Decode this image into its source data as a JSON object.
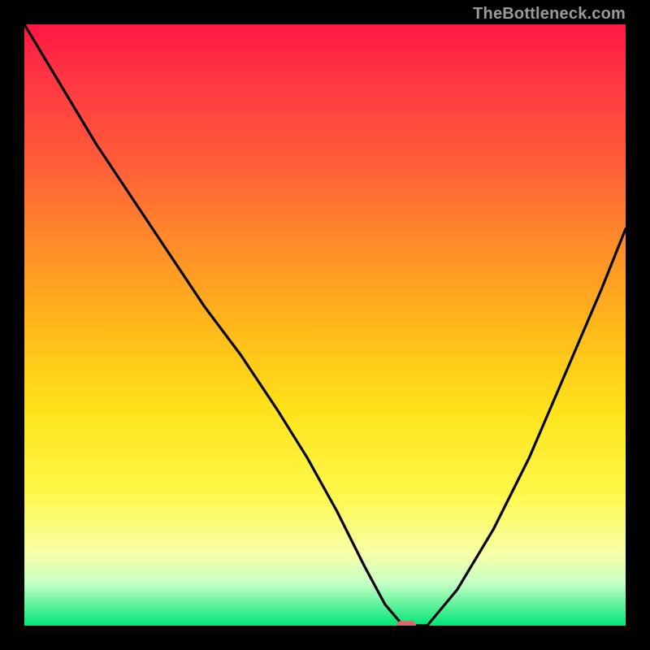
{
  "attribution": "TheBottleneck.com",
  "colors": {
    "background": "#000000",
    "curve": "#000000",
    "marker": "#d96a6a",
    "text": "#9a9a9a"
  },
  "chart_data": {
    "type": "line",
    "title": "",
    "xlabel": "",
    "ylabel": "",
    "xlim": [
      0,
      100
    ],
    "ylim": [
      0,
      100
    ],
    "curve": {
      "x": [
        0,
        6,
        12,
        18,
        24,
        30,
        36,
        42,
        47,
        52,
        56.5,
        60,
        63,
        67,
        72,
        78,
        84,
        90,
        96,
        100
      ],
      "y": [
        100,
        90,
        80,
        71,
        62,
        53,
        45,
        36,
        28,
        19,
        10,
        3.5,
        0,
        0,
        6,
        16,
        28,
        42,
        56,
        66
      ]
    },
    "marker": {
      "x": 63.5,
      "y": 0
    },
    "gradient_stops": [
      {
        "pct": 0,
        "color": "#ff1744"
      },
      {
        "pct": 8,
        "color": "#ff3344"
      },
      {
        "pct": 22,
        "color": "#ff5a3a"
      },
      {
        "pct": 36,
        "color": "#ff8a2a"
      },
      {
        "pct": 50,
        "color": "#ffb71a"
      },
      {
        "pct": 64,
        "color": "#ffe21a"
      },
      {
        "pct": 78,
        "color": "#fff84a"
      },
      {
        "pct": 88,
        "color": "#f8ffa8"
      },
      {
        "pct": 93,
        "color": "#c4ffc4"
      },
      {
        "pct": 100,
        "color": "#00e676"
      }
    ]
  }
}
